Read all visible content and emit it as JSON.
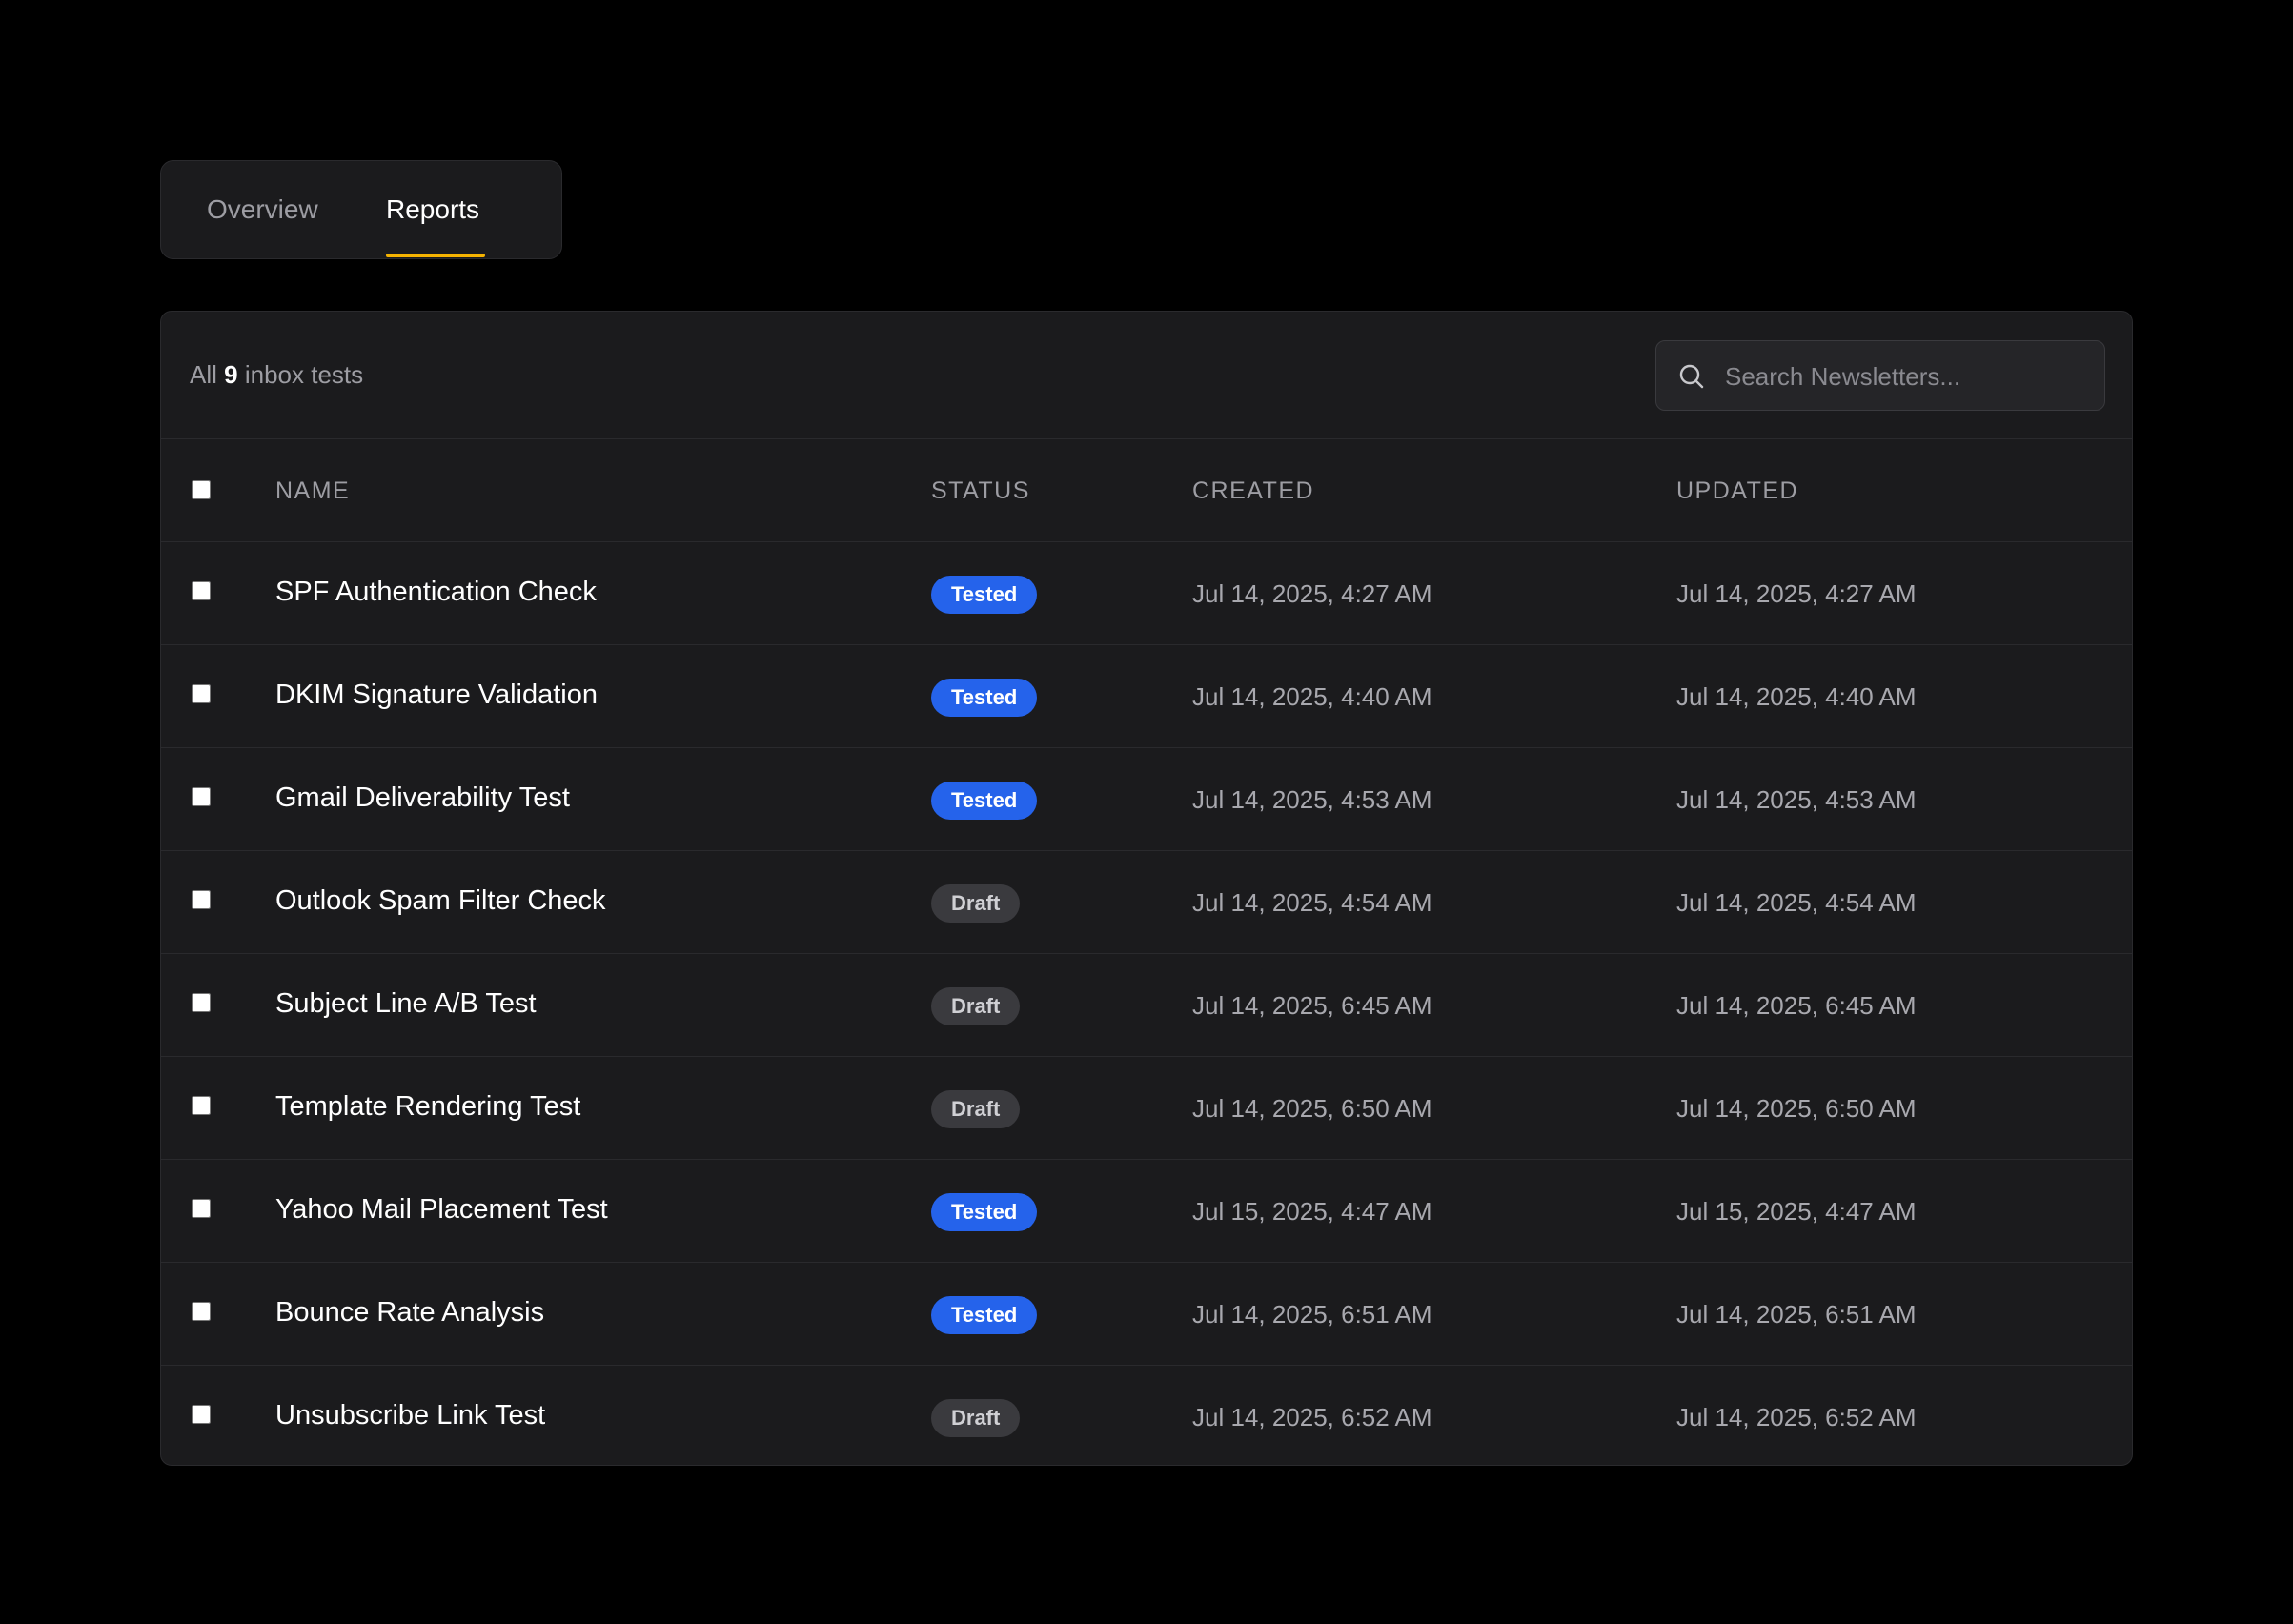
{
  "tabs": [
    {
      "label": "Overview",
      "active": false
    },
    {
      "label": "Reports",
      "active": true
    }
  ],
  "accent_color": "#f5b301",
  "summary": {
    "prefix": "All",
    "count": "9",
    "suffix": "inbox tests"
  },
  "search": {
    "placeholder": "Search Newsletters...",
    "value": "",
    "icon": "search-icon"
  },
  "table": {
    "columns": [
      "NAME",
      "STATUS",
      "CREATED",
      "UPDATED"
    ],
    "rows": [
      {
        "name": "SPF Authentication Check",
        "status": "Tested",
        "created": "Jul 14, 2025, 4:27 AM",
        "updated": "Jul 14, 2025, 4:27 AM"
      },
      {
        "name": "DKIM Signature Validation",
        "status": "Tested",
        "created": "Jul 14, 2025, 4:40 AM",
        "updated": "Jul 14, 2025, 4:40 AM"
      },
      {
        "name": "Gmail Deliverability Test",
        "status": "Tested",
        "created": "Jul 14, 2025, 4:53 AM",
        "updated": "Jul 14, 2025, 4:53 AM"
      },
      {
        "name": "Outlook Spam Filter Check",
        "status": "Draft",
        "created": "Jul 14, 2025, 4:54 AM",
        "updated": "Jul 14, 2025, 4:54 AM"
      },
      {
        "name": "Subject Line A/B Test",
        "status": "Draft",
        "created": "Jul 14, 2025, 6:45 AM",
        "updated": "Jul 14, 2025, 6:45 AM"
      },
      {
        "name": "Template Rendering Test",
        "status": "Draft",
        "created": "Jul 14, 2025, 6:50 AM",
        "updated": "Jul 14, 2025, 6:50 AM"
      },
      {
        "name": "Yahoo Mail Placement Test",
        "status": "Tested",
        "created": "Jul 15, 2025, 4:47 AM",
        "updated": "Jul 15, 2025, 4:47 AM"
      },
      {
        "name": "Bounce Rate Analysis",
        "status": "Tested",
        "created": "Jul 14, 2025, 6:51 AM",
        "updated": "Jul 14, 2025, 6:51 AM"
      },
      {
        "name": "Unsubscribe Link Test",
        "status": "Draft",
        "created": "Jul 14, 2025, 6:52 AM",
        "updated": "Jul 14, 2025, 6:52 AM"
      }
    ]
  },
  "status_colors": {
    "Tested": "#2563eb",
    "Draft": "#3a3a3e"
  }
}
